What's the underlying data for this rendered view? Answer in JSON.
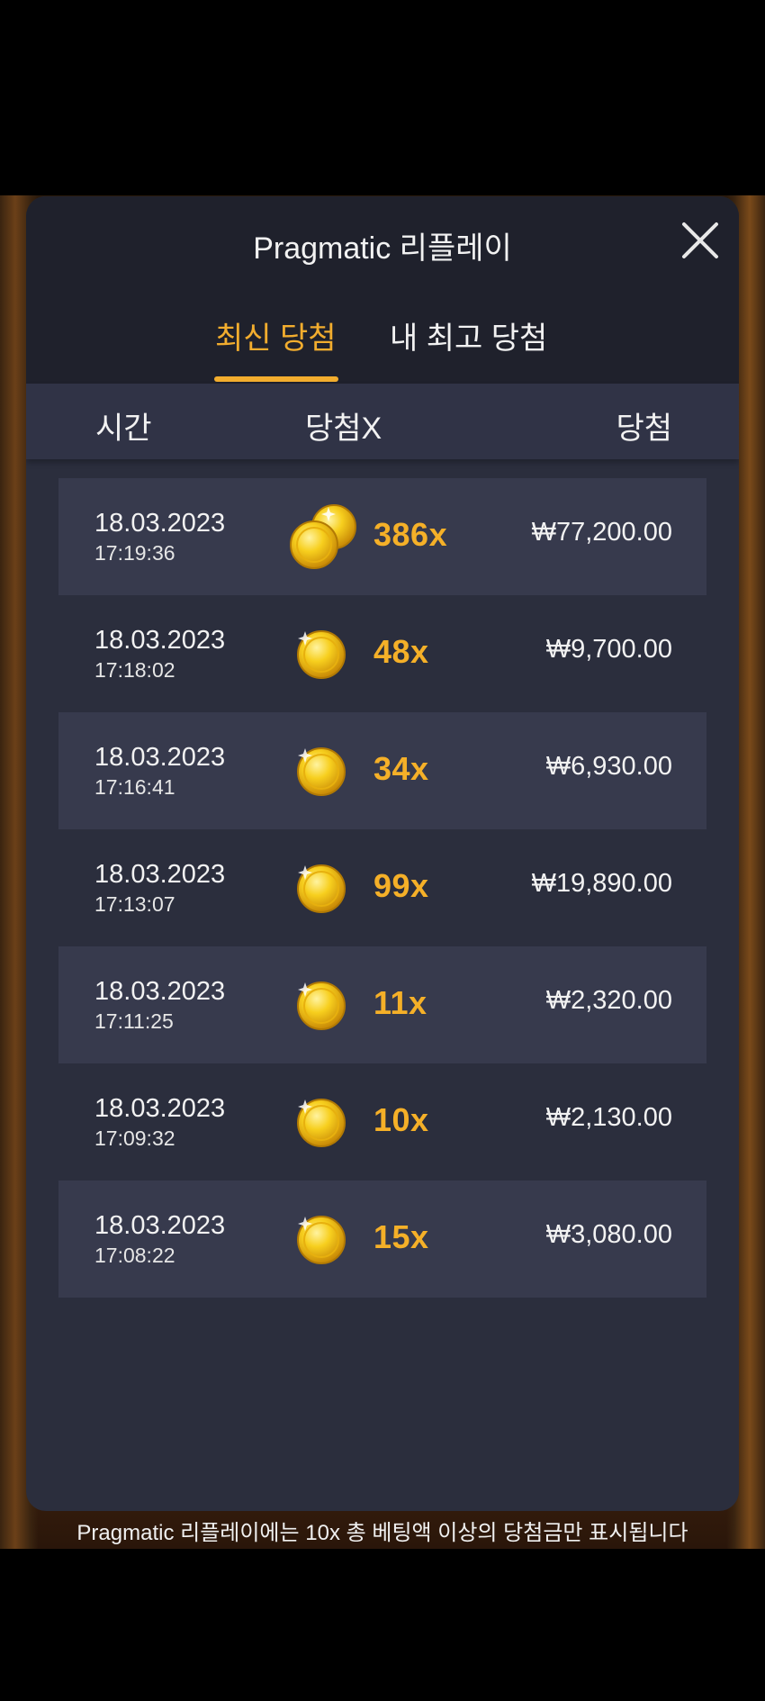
{
  "modal": {
    "title": "Pragmatic 리플레이",
    "close_icon": "close-icon"
  },
  "tabs": [
    {
      "label": "최신 당첨",
      "active": true
    },
    {
      "label": "내 최고 당첨",
      "active": false
    }
  ],
  "columns": {
    "time": "시간",
    "multiplier": "당첨X",
    "win": "당첨"
  },
  "rows": [
    {
      "date": "18.03.2023",
      "time": "17:19:36",
      "coin_icon": "double-coin-icon",
      "multiplier": "386x",
      "win": "₩77,200.00"
    },
    {
      "date": "18.03.2023",
      "time": "17:18:02",
      "coin_icon": "coin-icon",
      "multiplier": "48x",
      "win": "₩9,700.00"
    },
    {
      "date": "18.03.2023",
      "time": "17:16:41",
      "coin_icon": "coin-icon",
      "multiplier": "34x",
      "win": "₩6,930.00"
    },
    {
      "date": "18.03.2023",
      "time": "17:13:07",
      "coin_icon": "coin-icon",
      "multiplier": "99x",
      "win": "₩19,890.00"
    },
    {
      "date": "18.03.2023",
      "time": "17:11:25",
      "coin_icon": "coin-icon",
      "multiplier": "11x",
      "win": "₩2,320.00"
    },
    {
      "date": "18.03.2023",
      "time": "17:09:32",
      "coin_icon": "coin-icon",
      "multiplier": "10x",
      "win": "₩2,130.00"
    },
    {
      "date": "18.03.2023",
      "time": "17:08:22",
      "coin_icon": "coin-icon",
      "multiplier": "15x",
      "win": "₩3,080.00"
    }
  ],
  "footer": {
    "note": "Pragmatic 리플레이에는 10x 총 베팅액 이상의 당첨금만 표시됩니다"
  },
  "colors": {
    "accent": "#f2ad2e",
    "modal_bg": "#2b2e3d",
    "header_bg": "#1f212c",
    "row_shaded": "#373a4d"
  }
}
